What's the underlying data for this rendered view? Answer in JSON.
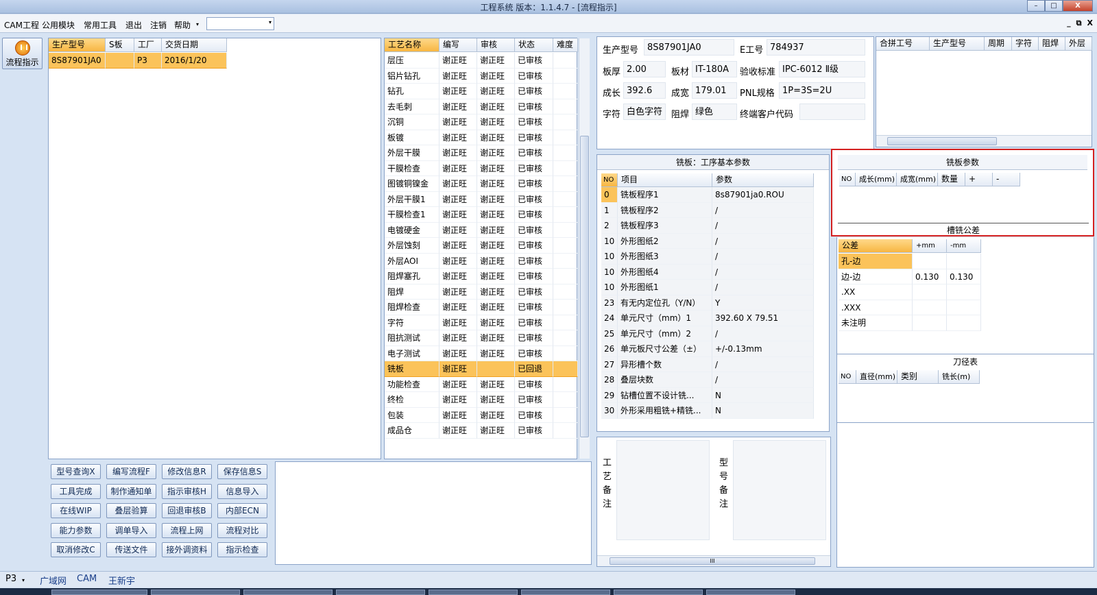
{
  "window": {
    "title": "工程系统   版本：1.1.4.7 - [流程指示]"
  },
  "window_buttons": [
    "–",
    "□",
    "X"
  ],
  "menu": [
    "CAM工程",
    "公用模块",
    "常用工具",
    "退出",
    "注销",
    "帮助"
  ],
  "menu_dropdown_arrow": "▾",
  "mdi_controls": [
    "_",
    "⧉",
    "X"
  ],
  "flow_button": {
    "label": "流程指示"
  },
  "order_grid": {
    "headers": [
      "生产型号",
      "S板",
      "工厂",
      "交货日期"
    ],
    "rows": [
      {
        "model": "8S87901JA0",
        "s": "",
        "factory": "P3",
        "date": "2016/1/20"
      }
    ]
  },
  "process_grid": {
    "headers": [
      "工艺名称",
      "编写",
      "审核",
      "状态",
      "难度"
    ],
    "rows": [
      [
        "层压",
        "谢正旺",
        "谢正旺",
        "已审核",
        ""
      ],
      [
        "铝片钻孔",
        "谢正旺",
        "谢正旺",
        "已审核",
        ""
      ],
      [
        "钻孔",
        "谢正旺",
        "谢正旺",
        "已审核",
        ""
      ],
      [
        "去毛刺",
        "谢正旺",
        "谢正旺",
        "已审核",
        ""
      ],
      [
        "沉铜",
        "谢正旺",
        "谢正旺",
        "已审核",
        ""
      ],
      [
        "板镀",
        "谢正旺",
        "谢正旺",
        "已审核",
        ""
      ],
      [
        "外层干膜",
        "谢正旺",
        "谢正旺",
        "已审核",
        ""
      ],
      [
        "干膜检查",
        "谢正旺",
        "谢正旺",
        "已审核",
        ""
      ],
      [
        "图镀铜镍金",
        "谢正旺",
        "谢正旺",
        "已审核",
        ""
      ],
      [
        "外层干膜1",
        "谢正旺",
        "谢正旺",
        "已审核",
        ""
      ],
      [
        "干膜检查1",
        "谢正旺",
        "谢正旺",
        "已审核",
        ""
      ],
      [
        "电镀硬金",
        "谢正旺",
        "谢正旺",
        "已审核",
        ""
      ],
      [
        "外层蚀刻",
        "谢正旺",
        "谢正旺",
        "已审核",
        ""
      ],
      [
        "外层AOI",
        "谢正旺",
        "谢正旺",
        "已审核",
        ""
      ],
      [
        "阻焊塞孔",
        "谢正旺",
        "谢正旺",
        "已审核",
        ""
      ],
      [
        "阻焊",
        "谢正旺",
        "谢正旺",
        "已审核",
        ""
      ],
      [
        "阻焊检查",
        "谢正旺",
        "谢正旺",
        "已审核",
        ""
      ],
      [
        "字符",
        "谢正旺",
        "谢正旺",
        "已审核",
        ""
      ],
      [
        "阻抗测试",
        "谢正旺",
        "谢正旺",
        "已审核",
        ""
      ],
      [
        "电子测试",
        "谢正旺",
        "谢正旺",
        "已审核",
        ""
      ],
      [
        "铣板",
        "谢正旺",
        "",
        "已回退",
        ""
      ],
      [
        "功能检查",
        "谢正旺",
        "谢正旺",
        "已审核",
        ""
      ],
      [
        "终检",
        "谢正旺",
        "谢正旺",
        "已审核",
        ""
      ],
      [
        "包装",
        "谢正旺",
        "谢正旺",
        "已审核",
        ""
      ],
      [
        "成品仓",
        "谢正旺",
        "谢正旺",
        "已审核",
        ""
      ]
    ],
    "highlighted_row": 20
  },
  "product_info": {
    "model_label": "生产型号",
    "model": "8S87901JA0",
    "e_label": "E工号",
    "e_no": "784937",
    "thickness_label": "板厚",
    "thickness": "2.00",
    "material_label": "板材",
    "material": "IT-180A",
    "standard_label": "验收标准",
    "standard": "IPC-6012 Ⅱ级",
    "length_label": "成长",
    "length": "392.6",
    "width_label": "成宽",
    "width": "179.01",
    "pnl_label": "PNL规格",
    "pnl": "1P=3S=2U",
    "char_label": "字符",
    "char": "白色字符",
    "mask_label": "阻焊",
    "mask": "绿色",
    "customer_label": "终端客户代码",
    "customer": ""
  },
  "merge_grid": {
    "headers": [
      "合拼工号",
      "生产型号",
      "周期",
      "字符",
      "阻焊",
      "外层"
    ]
  },
  "basic_params": {
    "title": "铣板：工序基本参数",
    "headers": [
      "NO",
      "项目",
      "参数"
    ],
    "rows": [
      [
        "0",
        "铣板程序1",
        "8s87901ja0.ROU"
      ],
      [
        "1",
        "铣板程序2",
        "/"
      ],
      [
        "2",
        "铣板程序3",
        "/"
      ],
      [
        "10",
        "外形图纸2",
        "/"
      ],
      [
        "10",
        "外形图纸3",
        "/"
      ],
      [
        "10",
        "外形图纸4",
        "/"
      ],
      [
        "10",
        "外形图纸1",
        "/"
      ],
      [
        "23",
        "有无内定位孔（Y/N）",
        "Y"
      ],
      [
        "24",
        "单元尺寸（mm）1",
        "392.60 X 79.51"
      ],
      [
        "25",
        "单元尺寸（mm）2",
        "/"
      ],
      [
        "26",
        "单元板尺寸公差（±）",
        "+/-0.13mm"
      ],
      [
        "27",
        "异形槽个数",
        "/"
      ],
      [
        "28",
        "叠层块数",
        "/"
      ],
      [
        "29",
        "钻槽位置不设计铣...",
        "N"
      ],
      [
        "30",
        "外形采用粗铣+精铣...",
        "N"
      ]
    ]
  },
  "mill_params": {
    "title": "铣板参数",
    "headers": [
      "NO",
      "成长(mm)",
      "成宽(mm)",
      "数量",
      "+",
      "-"
    ]
  },
  "slot_tolerance": {
    "title": "槽铣公差",
    "headers": [
      "公差",
      "+mm",
      "-mm"
    ],
    "rows": [
      [
        "孔-边",
        "",
        ""
      ],
      [
        "边-边",
        "0.130",
        "0.130"
      ],
      [
        ".XX",
        "",
        ""
      ],
      [
        ".XXX",
        "",
        ""
      ],
      [
        "未注明",
        "",
        ""
      ]
    ]
  },
  "tool_table": {
    "title": "刀径表",
    "headers": [
      "NO",
      "直径(mm)",
      "类别",
      "铣长(m)"
    ]
  },
  "remarks": {
    "process_label": "工艺备注",
    "model_label": "型号备注",
    "hscroll_mark": "III"
  },
  "buttons": [
    [
      "型号查询X",
      "编写流程F",
      "修改信息R",
      "保存信息S"
    ],
    [
      "工具完成",
      "制作通知单",
      "指示审核H",
      "信息导入"
    ],
    [
      "在线WIP",
      "叠层验算",
      "回退审核B",
      "内部ECN"
    ],
    [
      "能力参数",
      "调单导入",
      "流程上网",
      "流程对比"
    ],
    [
      "取消修改C",
      "传送文件",
      "接外调资料",
      "指示检查"
    ]
  ],
  "status_bar": {
    "factory": "P3",
    "net": "广域网",
    "dept": "CAM",
    "user": "王新宇"
  },
  "colors": {
    "highlight": "#fbc35a",
    "frame": "#8aa3c8",
    "red_frame": "#d42020"
  }
}
